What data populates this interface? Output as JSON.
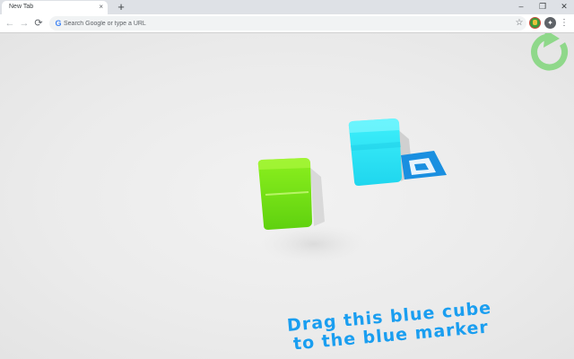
{
  "browser": {
    "tab_title": "New Tab",
    "tab_close": "×",
    "new_tab": "+",
    "window_controls": {
      "minimize": "–",
      "restore": "❐",
      "close": "✕"
    },
    "nav": {
      "back": "←",
      "forward": "→",
      "reload": "⟳"
    },
    "omnibox": {
      "placeholder": "Search Google or type a URL",
      "engine_icon": "G"
    },
    "star": "☆",
    "extension": "✦",
    "menu": "⋮"
  },
  "game": {
    "instruction_line1": "Drag this blue cube",
    "instruction_line2": "to the blue marker",
    "colors": {
      "blue_cube": "#2ee6f5",
      "green_cube": "#7ae81a",
      "marker": "#1a8fe0",
      "restart_icon": "#8fd88a",
      "text": "#1a9ef0"
    },
    "icons": [
      "restart-icon",
      "blue-cube",
      "green-cube",
      "blue-marker"
    ]
  }
}
